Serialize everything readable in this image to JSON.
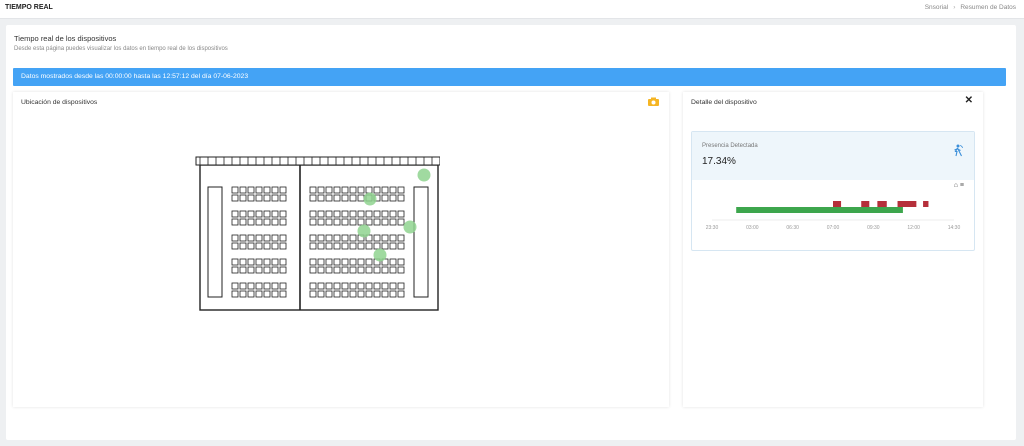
{
  "header": {
    "title": "TIEMPO REAL",
    "breadcrumb": [
      "Snsorial",
      "Resumen de Datos"
    ]
  },
  "page": {
    "heading": "Tiempo real de los dispositivos",
    "subheading": "Desde esta página puedes visualizar los datos en tiempo real de los dispositivos",
    "info_banner": "Datos mostrados desde las 00:00:00 hasta las 12:57:12 del día 07-06-2023"
  },
  "left_panel": {
    "title": "Ubicación de dispositivos",
    "icon": "camera-icon"
  },
  "right_panel": {
    "title": "Detalle del dispositivo",
    "close_icon": "close-icon",
    "metric_label": "Presencia Detectada",
    "metric_value": "17.34%",
    "metric_icon": "person-presence-icon",
    "toolbar_icons": [
      "home-icon",
      "menu-icon"
    ]
  },
  "colors": {
    "accent": "#44a3f5",
    "present": "#b52f3a",
    "absent": "#3da64d",
    "camera": "#f5b524",
    "device": "#8fd38f"
  },
  "chart_data": {
    "type": "timeline",
    "x_ticks": [
      "23:30",
      "03:00",
      "06:30",
      "07:00",
      "09:30",
      "12:00",
      "14:30"
    ],
    "segments": [
      {
        "start": "01:00",
        "end": "11:20",
        "state": "absent"
      },
      {
        "start": "07:00",
        "end": "07:30",
        "state": "present"
      },
      {
        "start": "08:45",
        "end": "09:15",
        "state": "present"
      },
      {
        "start": "09:45",
        "end": "10:20",
        "state": "present"
      },
      {
        "start": "11:00",
        "end": "12:10",
        "state": "present"
      },
      {
        "start": "12:35",
        "end": "12:55",
        "state": "present"
      }
    ]
  }
}
